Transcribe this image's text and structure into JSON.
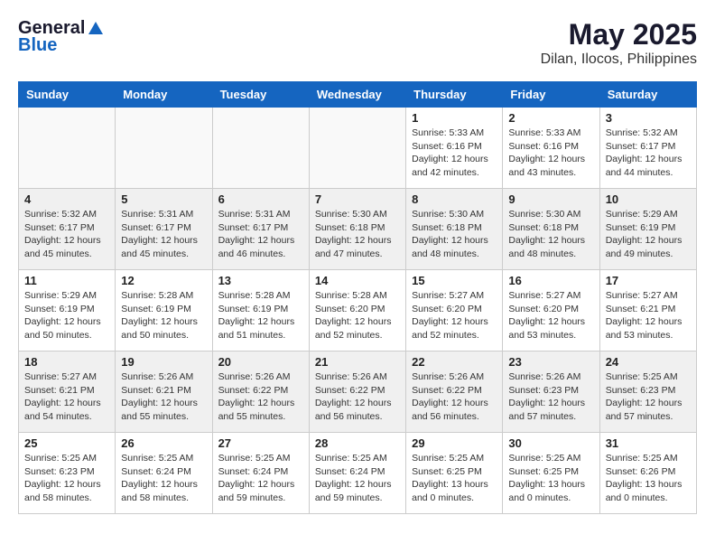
{
  "header": {
    "logo_general": "General",
    "logo_blue": "Blue",
    "month_year": "May 2025",
    "location": "Dilan, Ilocos, Philippines"
  },
  "days_of_week": [
    "Sunday",
    "Monday",
    "Tuesday",
    "Wednesday",
    "Thursday",
    "Friday",
    "Saturday"
  ],
  "weeks": [
    [
      {
        "day": "",
        "info": ""
      },
      {
        "day": "",
        "info": ""
      },
      {
        "day": "",
        "info": ""
      },
      {
        "day": "",
        "info": ""
      },
      {
        "day": "1",
        "info": "Sunrise: 5:33 AM\nSunset: 6:16 PM\nDaylight: 12 hours\nand 42 minutes."
      },
      {
        "day": "2",
        "info": "Sunrise: 5:33 AM\nSunset: 6:16 PM\nDaylight: 12 hours\nand 43 minutes."
      },
      {
        "day": "3",
        "info": "Sunrise: 5:32 AM\nSunset: 6:17 PM\nDaylight: 12 hours\nand 44 minutes."
      }
    ],
    [
      {
        "day": "4",
        "info": "Sunrise: 5:32 AM\nSunset: 6:17 PM\nDaylight: 12 hours\nand 45 minutes."
      },
      {
        "day": "5",
        "info": "Sunrise: 5:31 AM\nSunset: 6:17 PM\nDaylight: 12 hours\nand 45 minutes."
      },
      {
        "day": "6",
        "info": "Sunrise: 5:31 AM\nSunset: 6:17 PM\nDaylight: 12 hours\nand 46 minutes."
      },
      {
        "day": "7",
        "info": "Sunrise: 5:30 AM\nSunset: 6:18 PM\nDaylight: 12 hours\nand 47 minutes."
      },
      {
        "day": "8",
        "info": "Sunrise: 5:30 AM\nSunset: 6:18 PM\nDaylight: 12 hours\nand 48 minutes."
      },
      {
        "day": "9",
        "info": "Sunrise: 5:30 AM\nSunset: 6:18 PM\nDaylight: 12 hours\nand 48 minutes."
      },
      {
        "day": "10",
        "info": "Sunrise: 5:29 AM\nSunset: 6:19 PM\nDaylight: 12 hours\nand 49 minutes."
      }
    ],
    [
      {
        "day": "11",
        "info": "Sunrise: 5:29 AM\nSunset: 6:19 PM\nDaylight: 12 hours\nand 50 minutes."
      },
      {
        "day": "12",
        "info": "Sunrise: 5:28 AM\nSunset: 6:19 PM\nDaylight: 12 hours\nand 50 minutes."
      },
      {
        "day": "13",
        "info": "Sunrise: 5:28 AM\nSunset: 6:19 PM\nDaylight: 12 hours\nand 51 minutes."
      },
      {
        "day": "14",
        "info": "Sunrise: 5:28 AM\nSunset: 6:20 PM\nDaylight: 12 hours\nand 52 minutes."
      },
      {
        "day": "15",
        "info": "Sunrise: 5:27 AM\nSunset: 6:20 PM\nDaylight: 12 hours\nand 52 minutes."
      },
      {
        "day": "16",
        "info": "Sunrise: 5:27 AM\nSunset: 6:20 PM\nDaylight: 12 hours\nand 53 minutes."
      },
      {
        "day": "17",
        "info": "Sunrise: 5:27 AM\nSunset: 6:21 PM\nDaylight: 12 hours\nand 53 minutes."
      }
    ],
    [
      {
        "day": "18",
        "info": "Sunrise: 5:27 AM\nSunset: 6:21 PM\nDaylight: 12 hours\nand 54 minutes."
      },
      {
        "day": "19",
        "info": "Sunrise: 5:26 AM\nSunset: 6:21 PM\nDaylight: 12 hours\nand 55 minutes."
      },
      {
        "day": "20",
        "info": "Sunrise: 5:26 AM\nSunset: 6:22 PM\nDaylight: 12 hours\nand 55 minutes."
      },
      {
        "day": "21",
        "info": "Sunrise: 5:26 AM\nSunset: 6:22 PM\nDaylight: 12 hours\nand 56 minutes."
      },
      {
        "day": "22",
        "info": "Sunrise: 5:26 AM\nSunset: 6:22 PM\nDaylight: 12 hours\nand 56 minutes."
      },
      {
        "day": "23",
        "info": "Sunrise: 5:26 AM\nSunset: 6:23 PM\nDaylight: 12 hours\nand 57 minutes."
      },
      {
        "day": "24",
        "info": "Sunrise: 5:25 AM\nSunset: 6:23 PM\nDaylight: 12 hours\nand 57 minutes."
      }
    ],
    [
      {
        "day": "25",
        "info": "Sunrise: 5:25 AM\nSunset: 6:23 PM\nDaylight: 12 hours\nand 58 minutes."
      },
      {
        "day": "26",
        "info": "Sunrise: 5:25 AM\nSunset: 6:24 PM\nDaylight: 12 hours\nand 58 minutes."
      },
      {
        "day": "27",
        "info": "Sunrise: 5:25 AM\nSunset: 6:24 PM\nDaylight: 12 hours\nand 59 minutes."
      },
      {
        "day": "28",
        "info": "Sunrise: 5:25 AM\nSunset: 6:24 PM\nDaylight: 12 hours\nand 59 minutes."
      },
      {
        "day": "29",
        "info": "Sunrise: 5:25 AM\nSunset: 6:25 PM\nDaylight: 13 hours\nand 0 minutes."
      },
      {
        "day": "30",
        "info": "Sunrise: 5:25 AM\nSunset: 6:25 PM\nDaylight: 13 hours\nand 0 minutes."
      },
      {
        "day": "31",
        "info": "Sunrise: 5:25 AM\nSunset: 6:26 PM\nDaylight: 13 hours\nand 0 minutes."
      }
    ]
  ]
}
